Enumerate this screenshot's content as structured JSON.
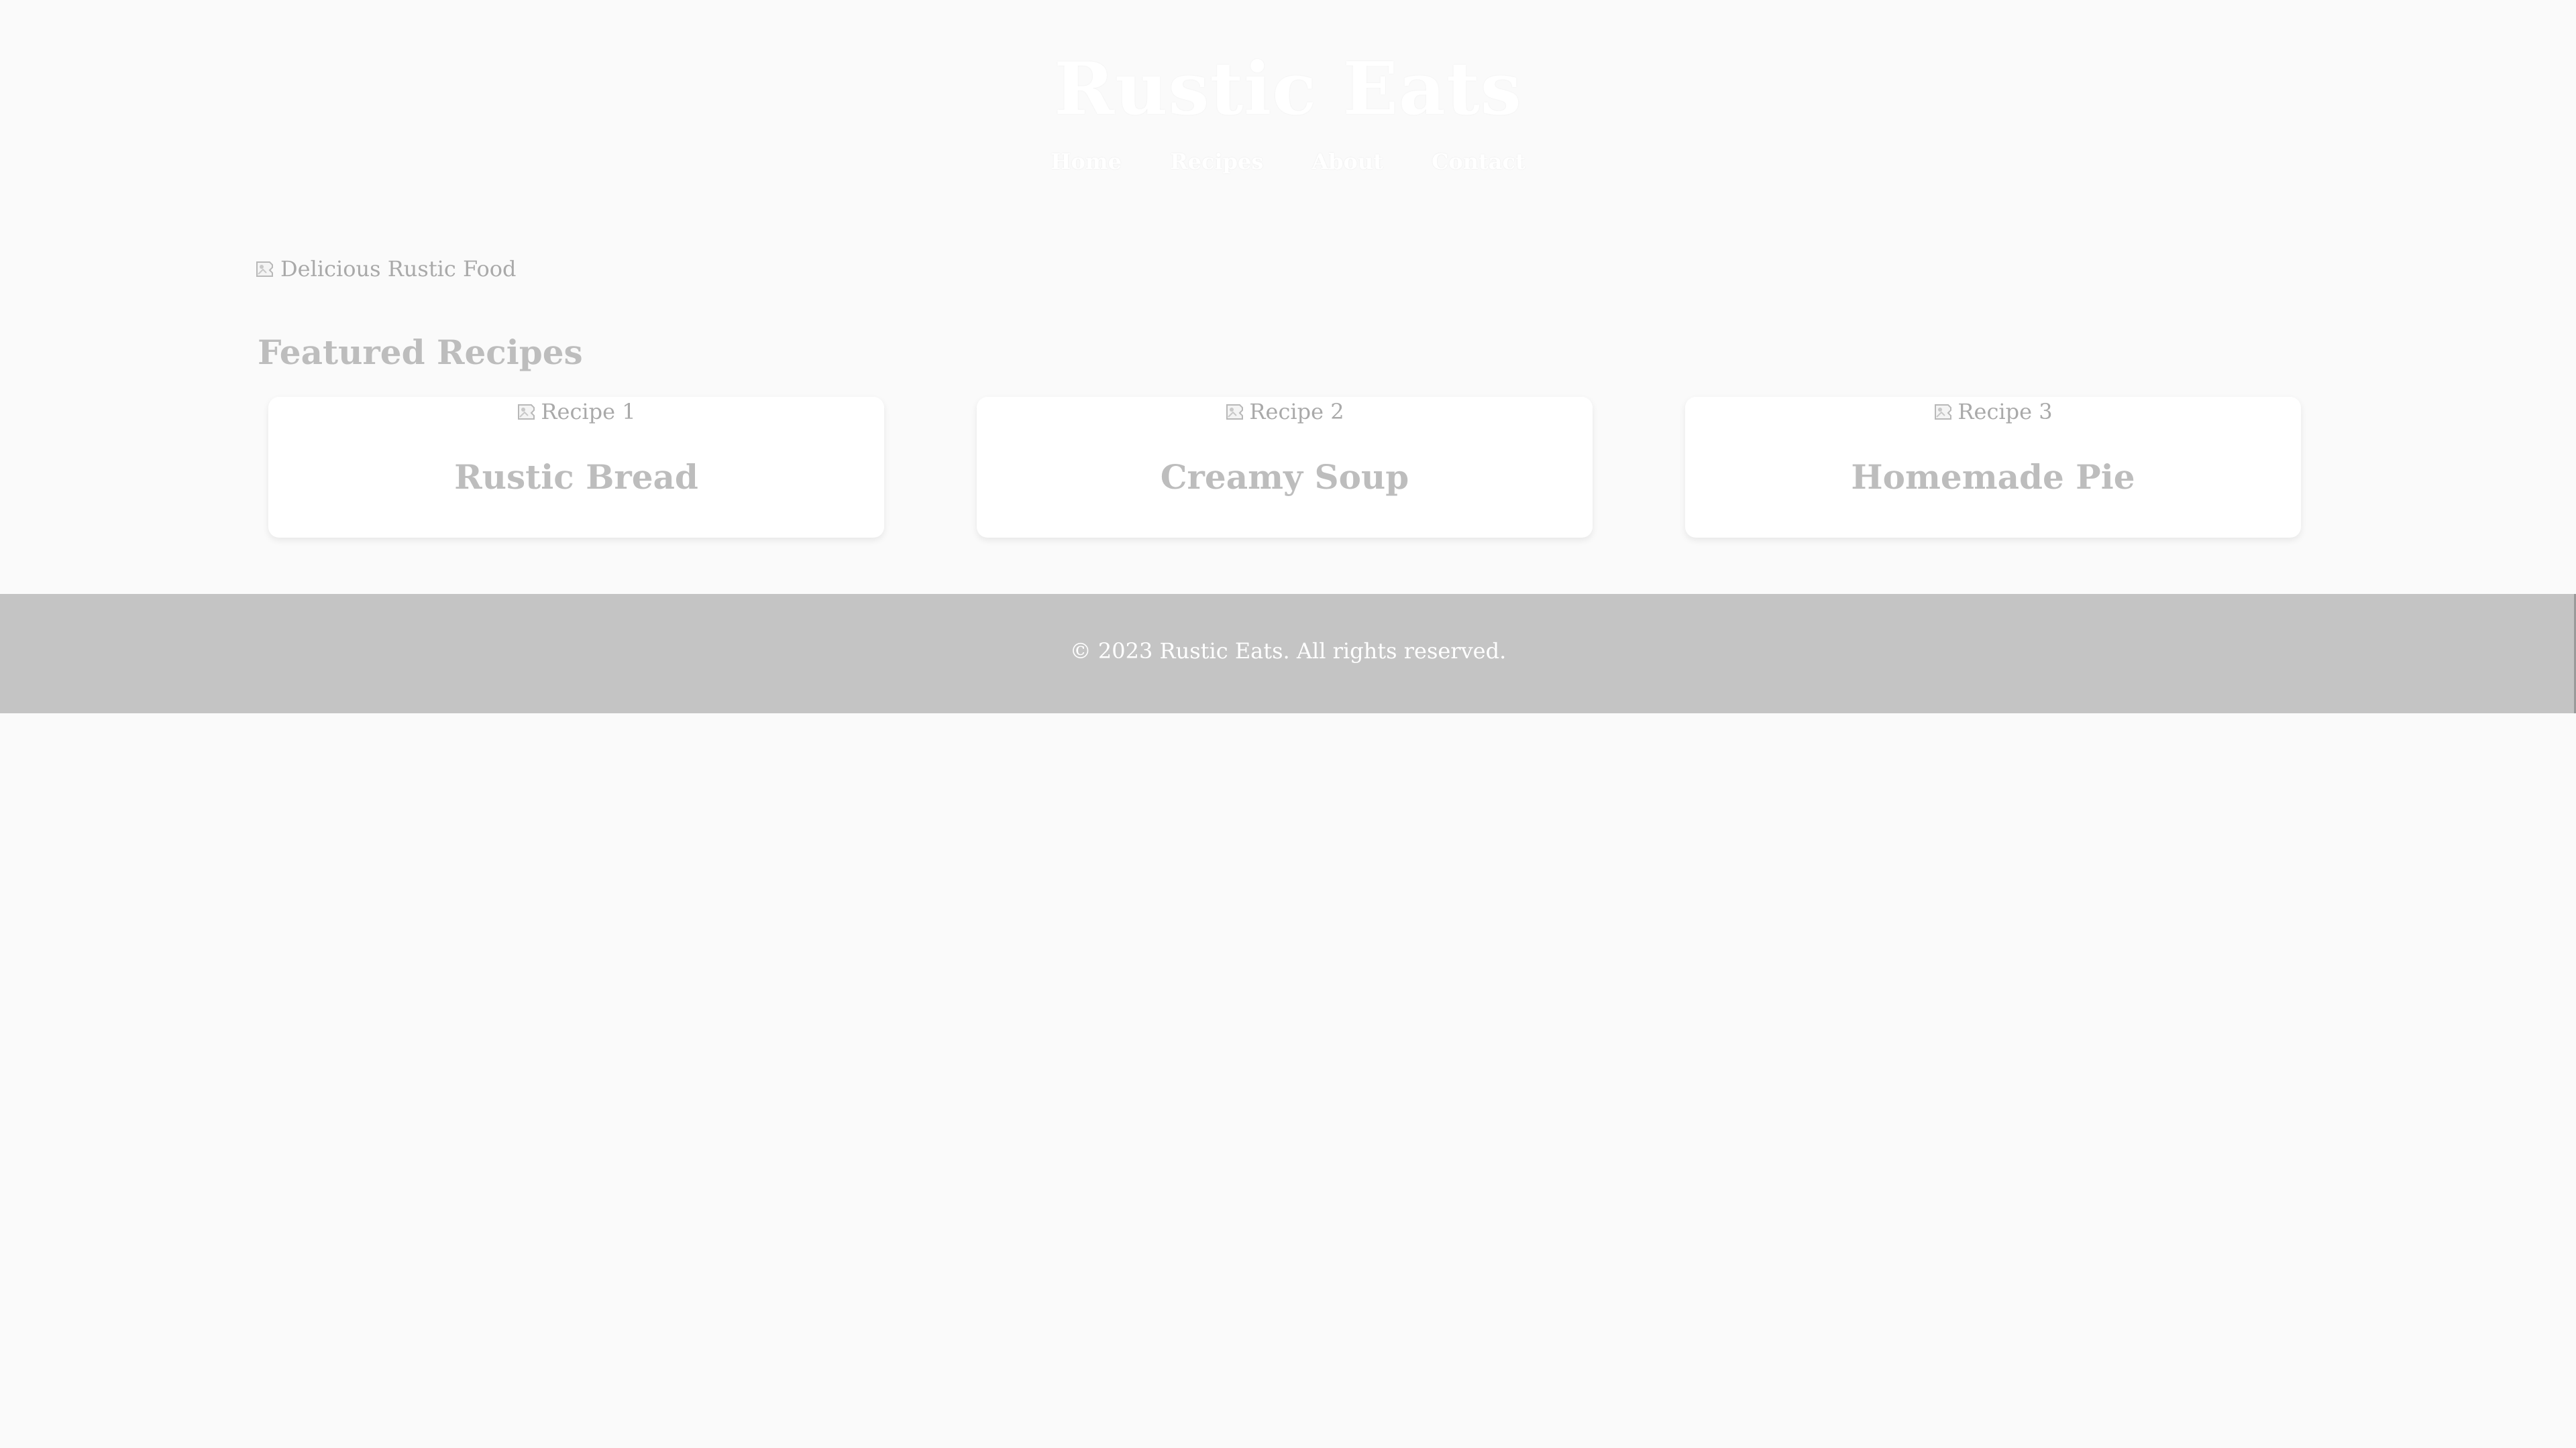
{
  "header": {
    "title": "Rustic Eats",
    "nav": [
      {
        "label": "Home"
      },
      {
        "label": "Recipes"
      },
      {
        "label": "About"
      },
      {
        "label": "Contact"
      }
    ]
  },
  "hero": {
    "image_alt": "Delicious Rustic Food",
    "icon": "broken-image-icon"
  },
  "featured": {
    "title": "Featured Recipes",
    "cards": [
      {
        "image_alt": "Recipe 1",
        "title": "Rustic Bread"
      },
      {
        "image_alt": "Recipe 2",
        "title": "Creamy Soup"
      },
      {
        "image_alt": "Recipe 3",
        "title": "Homemade Pie"
      }
    ]
  },
  "footer": {
    "text": "© 2023 Rustic Eats. All rights reserved."
  },
  "colors": {
    "page_background": "#fafafa",
    "footer_background": "#c4c4c4",
    "heading_text": "#bdbdbd",
    "alt_text": "#a9a9a9",
    "header_text": "#ffffff"
  }
}
